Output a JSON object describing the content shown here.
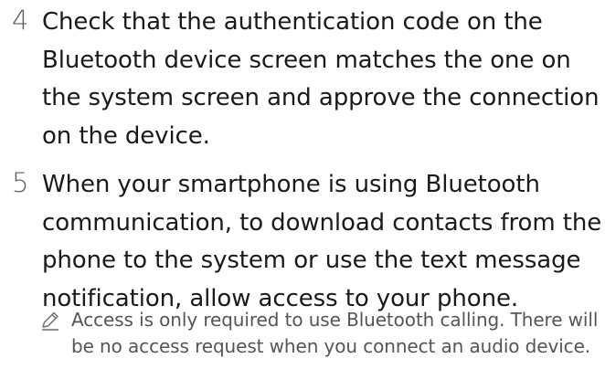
{
  "steps": [
    {
      "number": "4",
      "text": "Check that the authentication code on the Bluetooth device screen matches the one on the system screen and approve the connection on the device."
    },
    {
      "number": "5",
      "text": "When your smartphone is using Bluetooth communication, to download contacts from the phone to the system or use the text message notification, allow access to your phone."
    }
  ],
  "note": {
    "icon": "pencil-note-icon",
    "text": "Access is only required to use Bluetooth calling. There will be no access request when you connect an audio device."
  }
}
